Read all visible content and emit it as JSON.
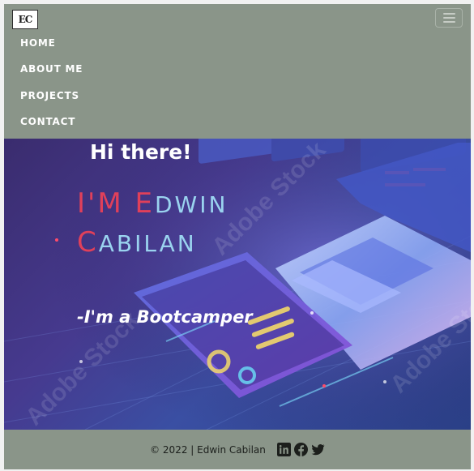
{
  "brand": {
    "logo_text": "EC"
  },
  "nav": {
    "toggler_icon": "hamburger-menu-icon",
    "items": [
      {
        "label": "HOME"
      },
      {
        "label": "ABOUT ME"
      },
      {
        "label": "PROJECTS"
      },
      {
        "label": "CONTACT"
      }
    ]
  },
  "hero": {
    "greeting": "Hi there!",
    "name_line1": {
      "first": "I'M E",
      "rest": "DWIN"
    },
    "name_line2": {
      "first": "C",
      "rest": "ABILAN"
    },
    "tagline": "-I'm a Bootcamper",
    "watermark": "Adobe Stock"
  },
  "footer": {
    "copyright": "© 2022 | Edwin Cabilan",
    "social_icons": [
      "linkedin-icon",
      "facebook-icon",
      "twitter-icon"
    ]
  },
  "colors": {
    "navbar_bg": "#8a9589",
    "name_color": "#9ad3ef",
    "accent_red": "#e0405a",
    "text_white": "#ffffff"
  }
}
